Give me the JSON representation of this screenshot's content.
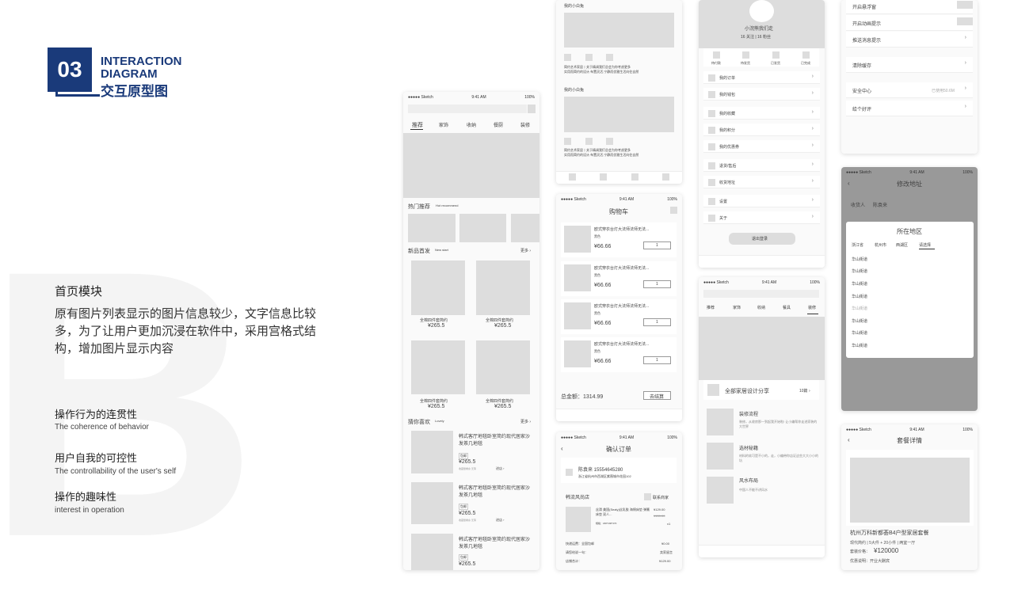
{
  "logo": {
    "num": "03",
    "line1": "INTERACTION",
    "line2": "DIAGRAM",
    "cn": "交互原型图"
  },
  "intro": {
    "title": "首页模块",
    "desc": "原有图片列表显示的图片信息较少，文字信息比较多，为了让用户更加沉浸在软件中，采用宫格式结构，增加图片显示内容"
  },
  "points": [
    {
      "cn": "操作行为的连贯性",
      "en": "The coherence of behavior"
    },
    {
      "cn": "用户自我的可控性",
      "en": "The controllability of the user's self"
    },
    {
      "cn": "操作的趣味性",
      "en": "interest in operation"
    }
  ],
  "status": {
    "carrier": "●●●●● Sketch",
    "time": "9:41 AM",
    "battery": "100%"
  },
  "home": {
    "tabs": [
      "推荐",
      "家饰",
      "收纳",
      "餐厨",
      "装修"
    ],
    "hot": "热门推荐",
    "hot_en": "Hot recommend",
    "new": "新品首发",
    "new_en": "New start",
    "more": "更多 ›",
    "product": "全棉四件套简约",
    "price": "¥265.5",
    "guess": "猜你喜欢",
    "guess_en": "Lovely",
    "item": "韩式客厅地毯卧室简约现代居家沙发茶几地毯",
    "tag": "包邮",
    "tag_note": "收藏量剩余 无薄",
    "enter": "进店 ›"
  },
  "feed": {
    "user": "我的小白兔",
    "text": "简约艺术家居丨关于精调我们总会为你考虑更多\n实用而简约的设计,布置灵活,宁静而优雅生活向往自然"
  },
  "cart": {
    "title": "购物车",
    "item": "欧式穿衣台灯大法师法师无法...",
    "color": "黑色",
    "price": "¥66.66",
    "qty": "1",
    "total": "总金额：1314.99",
    "checkout": "去结算"
  },
  "order": {
    "title": "确认订单",
    "name": "陈袁来  15554645280",
    "addr": "浙江省杭州市西湖区紫薇城市花园102",
    "shop": "韩流风尚店",
    "contact": "联系商家",
    "goods": "丝滑 美国(Sealy)丝乳胶 海绵床垫 弹簧床垫 双人...",
    "spec": "规格：180*200*270",
    "p1": "¥129.00",
    "p2": "¥159.00",
    "q": "x1",
    "ship_l": "快递运费：全国包邮",
    "ship_v": "¥0.00",
    "note_l": "请您给说一句：",
    "note_v": "卖家留言",
    "sum_l": "店铺合计：",
    "sum_v": "¥129.00"
  },
  "profile": {
    "name": "小浣熊我们走",
    "stats": "16 关注   |   16 粉丝",
    "tabs": [
      "待付款",
      "待发货",
      "已发货",
      "已完成"
    ],
    "rows": [
      "我的订单",
      "我的钱包",
      "我的收藏",
      "我的积分",
      "我的优惠券",
      "退货/售后",
      "收货地址",
      "设置",
      "关于"
    ],
    "logout": "退出登录"
  },
  "settings": {
    "rows": [
      "开启悬浮窗",
      "开启动画提示",
      "推送消息提示",
      "清除缓存",
      "安全中心",
      "给个好评"
    ],
    "used": "已使用50.6M"
  },
  "address": {
    "title": "修改地址",
    "receiver": "收货人",
    "rname": "陈袁来",
    "modal_title": "所在地区",
    "crumbs": [
      "浙江省",
      "杭州市",
      "西湖区",
      "请选择"
    ],
    "street": "华山街道"
  },
  "deco": {
    "tabs": [
      "推荐",
      "家饰",
      "收纳",
      "餐具",
      "装修"
    ],
    "card": "全部家居设计分享",
    "count": "10篇 ›",
    "items": [
      {
        "t": "装修流程",
        "d": "装修，从收房那一到起我开始啦! 让小编帮你走进家装的大世界"
      },
      {
        "t": "选材秘籍",
        "d": "材料的软可是不小的，走，小编带你店证这些大大小小的坑"
      },
      {
        "t": "风水布局",
        "d": "中国人不能不讲风水"
      }
    ]
  },
  "detail": {
    "title": "套餐详情",
    "name": "杭州万科新都荟B4户型家居套餐",
    "meta": "现代简约  |  5大件 + 20小件  |  两室一厅",
    "price_l": "套装价格：",
    "price": "¥120000",
    "promo": "优惠说明：开业大酬宾"
  },
  "nav": [
    "首页",
    "社区",
    "购物",
    "个人"
  ]
}
